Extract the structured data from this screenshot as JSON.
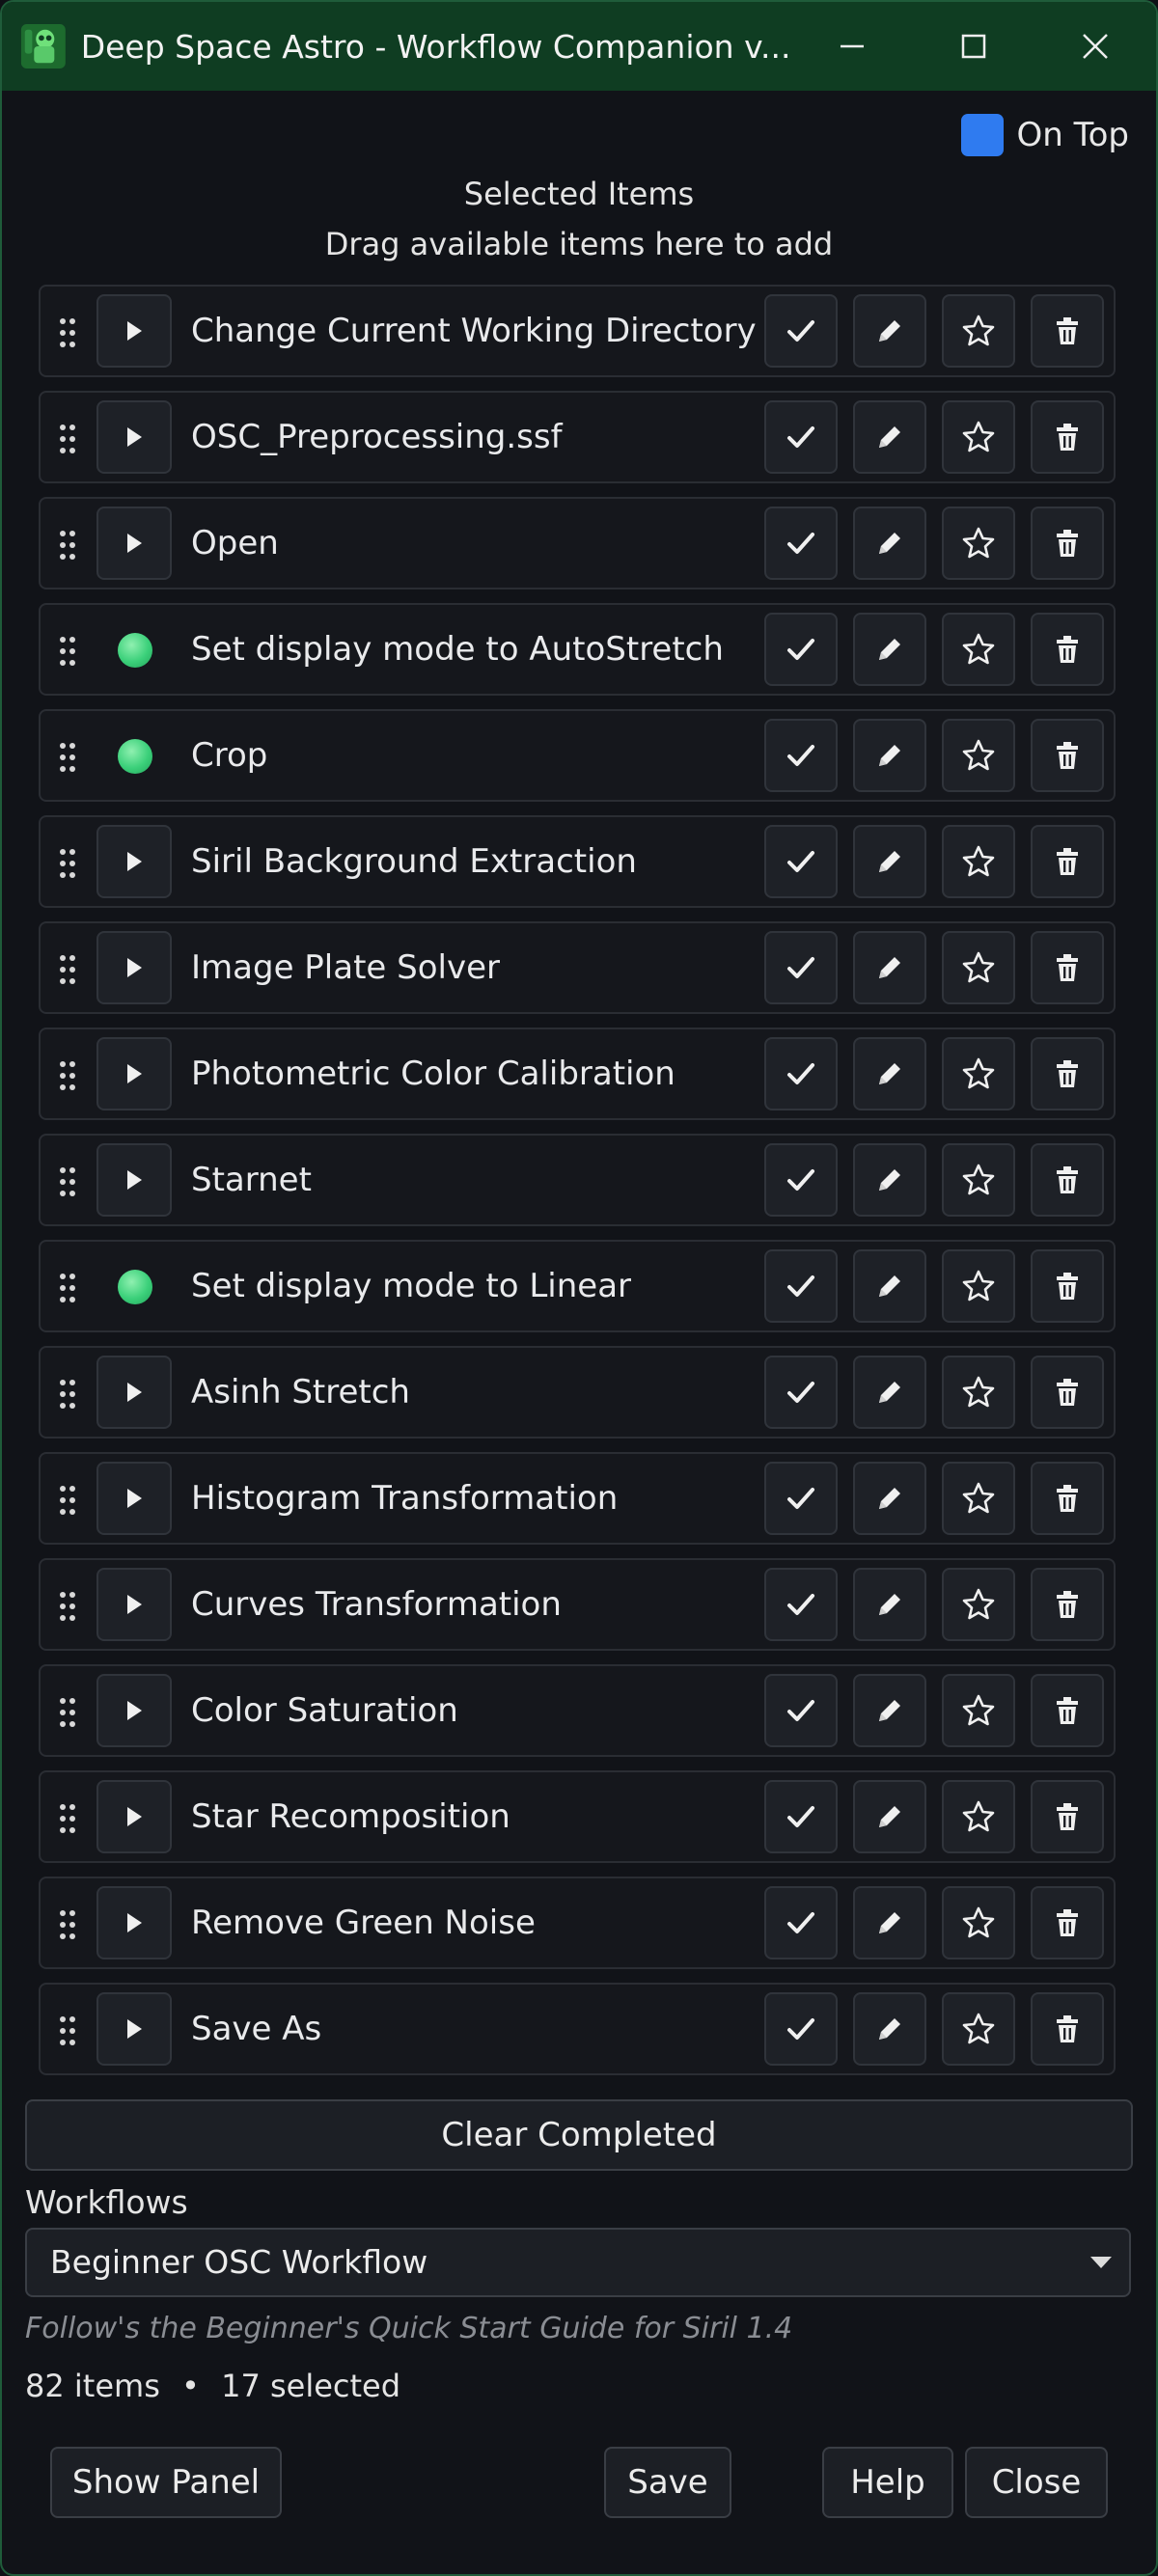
{
  "window": {
    "title": "Deep Space Astro - Workflow Companion  v...",
    "ontop_label": "On Top"
  },
  "selected": {
    "heading": "Selected Items",
    "hint": "Drag available items here to add",
    "items": [
      {
        "label": "Change Current Working Directory",
        "marker": "play"
      },
      {
        "label": "OSC_Preprocessing.ssf",
        "marker": "play"
      },
      {
        "label": "Open",
        "marker": "play"
      },
      {
        "label": "Set display mode to AutoStretch",
        "marker": "dot"
      },
      {
        "label": "Crop",
        "marker": "dot"
      },
      {
        "label": "Siril Background Extraction",
        "marker": "play"
      },
      {
        "label": "Image Plate Solver",
        "marker": "play"
      },
      {
        "label": "Photometric Color Calibration",
        "marker": "play"
      },
      {
        "label": "Starnet",
        "marker": "play"
      },
      {
        "label": "Set display mode to Linear",
        "marker": "dot"
      },
      {
        "label": "Asinh Stretch",
        "marker": "play"
      },
      {
        "label": "Histogram Transformation",
        "marker": "play"
      },
      {
        "label": "Curves Transformation",
        "marker": "play"
      },
      {
        "label": "Color Saturation",
        "marker": "play"
      },
      {
        "label": "Star Recomposition",
        "marker": "play"
      },
      {
        "label": "Remove Green Noise",
        "marker": "play"
      },
      {
        "label": "Save As",
        "marker": "play"
      }
    ]
  },
  "clear_completed_label": "Clear Completed",
  "workflows": {
    "label": "Workflows",
    "selected": "Beginner OSC Workflow",
    "description": "Follow's the Beginner's Quick Start Guide for Siril 1.4"
  },
  "status": {
    "items": "82 items",
    "separator": "•",
    "selected": "17 selected"
  },
  "footer": {
    "show_panel": "Show Panel",
    "save": "Save",
    "help": "Help",
    "close": "Close"
  },
  "colors": {
    "titlebar": "#0f3d22",
    "accent": "#2f7bf0",
    "dot": "#3bd07a"
  }
}
